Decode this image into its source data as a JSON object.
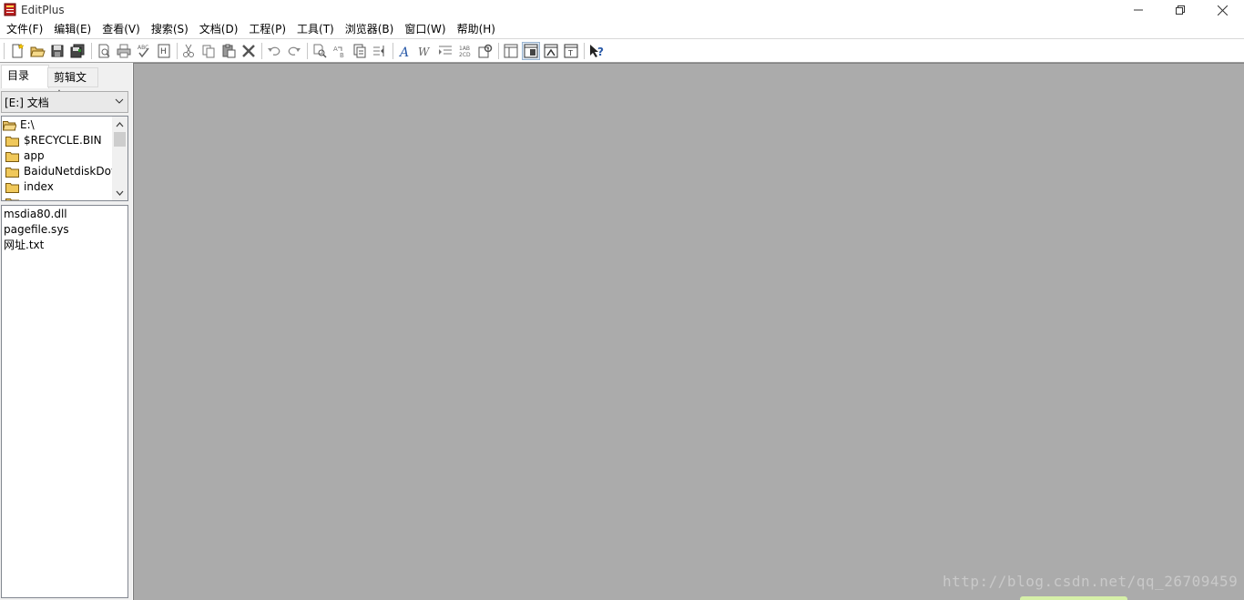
{
  "window": {
    "title": "EditPlus"
  },
  "menu": [
    {
      "label": "文件(F)"
    },
    {
      "label": "编辑(E)"
    },
    {
      "label": "查看(V)"
    },
    {
      "label": "搜索(S)"
    },
    {
      "label": "文档(D)"
    },
    {
      "label": "工程(P)"
    },
    {
      "label": "工具(T)"
    },
    {
      "label": "浏览器(B)"
    },
    {
      "label": "窗口(W)"
    },
    {
      "label": "帮助(H)"
    }
  ],
  "toolbar": {
    "icons": [
      "new-file-icon",
      "open-folder-icon",
      "save-icon",
      "save-all-icon",
      "print-preview-icon",
      "print-icon",
      "spell-check-icon",
      "html-preview-icon",
      "cut-icon",
      "copy-icon",
      "paste-icon",
      "delete-icon",
      "undo-icon",
      "redo-icon",
      "find-icon",
      "replace-icon",
      "find-in-files-icon",
      "goto-line-icon",
      "font-icon",
      "word-wrap-icon",
      "indent-icon",
      "line-numbers-icon",
      "settings-icon",
      "directory-window-icon",
      "cliptext-window-icon",
      "output-window-icon",
      "user-tools-icon",
      "help-icon"
    ]
  },
  "sidebar": {
    "tabs": [
      {
        "label": "目录"
      },
      {
        "label": "剪辑文本"
      }
    ],
    "drive": "[E:] 文档",
    "tree": [
      {
        "label": "E:\\"
      },
      {
        "label": "$RECYCLE.BIN"
      },
      {
        "label": "app"
      },
      {
        "label": "BaiduNetdiskDow"
      },
      {
        "label": "index"
      }
    ],
    "files": [
      {
        "label": "msdia80.dll"
      },
      {
        "label": "pagefile.sys"
      },
      {
        "label": "网址.txt"
      }
    ]
  },
  "watermark": "http://blog.csdn.net/qq_26709459"
}
